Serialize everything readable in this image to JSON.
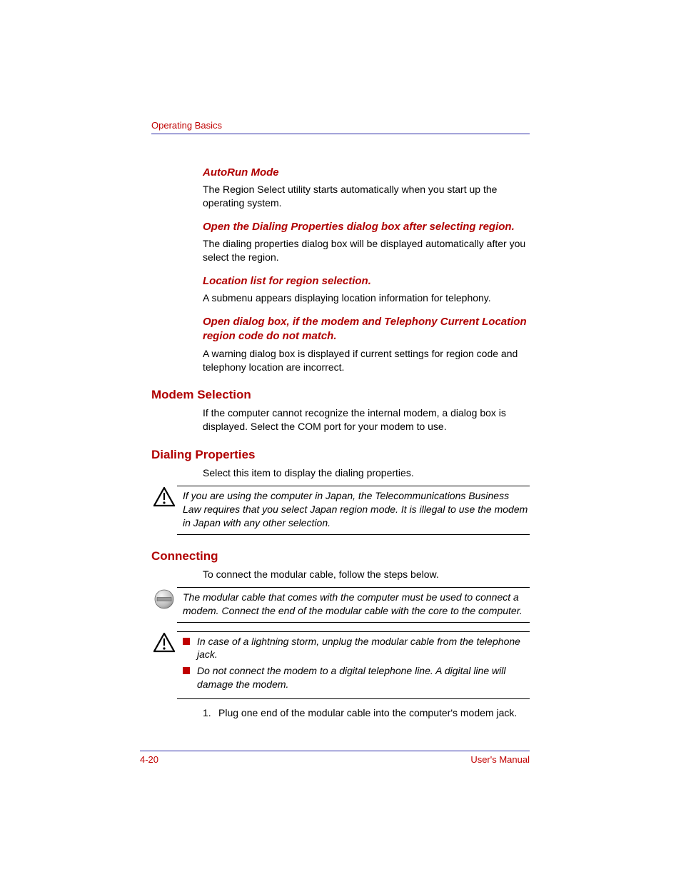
{
  "header": {
    "section": "Operating Basics"
  },
  "sections": {
    "autorun": {
      "heading": "AutoRun Mode",
      "body": "The Region Select utility starts automatically when you start up the operating system."
    },
    "openDialing": {
      "heading": "Open the Dialing Properties dialog box after selecting region.",
      "body": "The dialing properties dialog box will be displayed automatically after you select the region."
    },
    "locationList": {
      "heading": "Location list for region selection.",
      "body": "A submenu appears displaying location information for telephony."
    },
    "openDialogMismatch": {
      "heading": "Open dialog box, if the modem and Telephony Current Location region code do not match.",
      "body": "A warning dialog box is displayed if current settings for region code and telephony location are incorrect."
    },
    "modemSelection": {
      "heading": "Modem Selection",
      "body": "If the computer cannot recognize the internal modem, a dialog box is displayed. Select the COM port for your modem to use."
    },
    "dialingProperties": {
      "heading": "Dialing Properties",
      "body": "Select this item to display the dialing properties.",
      "caution": "If you are using the computer in Japan, the Telecommunications Business Law requires that you select Japan region mode. It is illegal to use the modem in Japan with any other selection."
    },
    "connecting": {
      "heading": "Connecting",
      "body": "To connect the modular cable, follow the steps below.",
      "note": "The modular cable that comes with the computer must be used to connect a modem. Connect the end of the modular cable with the core to the computer.",
      "warnings": [
        "In case of a lightning storm, unplug the modular cable from the telephone jack.",
        "Do not connect the modem to a digital telephone line. A digital line will damage the modem."
      ],
      "steps": {
        "1": "Plug one end of the modular cable into the computer's modem jack."
      }
    }
  },
  "footer": {
    "pageNumber": "4-20",
    "docTitle": "User's Manual"
  }
}
